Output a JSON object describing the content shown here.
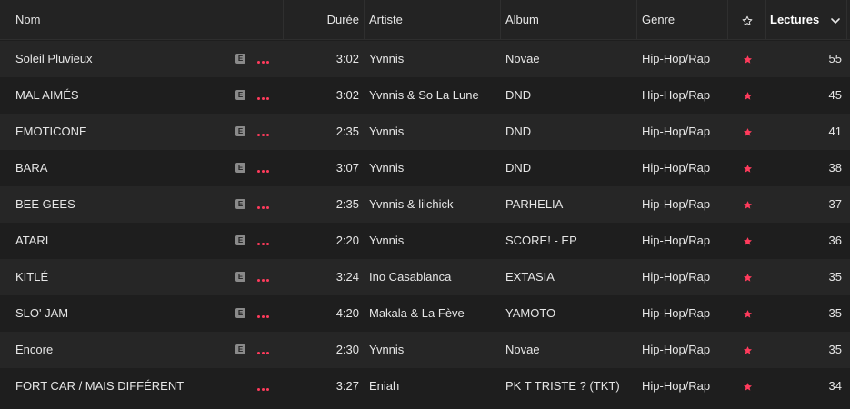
{
  "colors": {
    "accent": "#ff3b5c",
    "background": "#1e1e1e",
    "row_alt": "#262626",
    "header_bg": "#232323"
  },
  "header": {
    "nom": "Nom",
    "duree": "Durée",
    "artiste": "Artiste",
    "album": "Album",
    "genre": "Genre",
    "favorite_icon": "star-outline-icon",
    "lectures": "Lectures",
    "sort_icon": "chevron-down-icon"
  },
  "rows": [
    {
      "title": "Soleil Pluvieux",
      "explicit": true,
      "duration": "3:02",
      "artist": "Yvnnis",
      "album": "Novae",
      "genre": "Hip-Hop/Rap",
      "favorite": true,
      "plays": "55"
    },
    {
      "title": "MAL AIMÉS",
      "explicit": true,
      "duration": "3:02",
      "artist": "Yvnnis & So La Lune",
      "album": "DND",
      "genre": "Hip-Hop/Rap",
      "favorite": true,
      "plays": "45"
    },
    {
      "title": "EMOTICONE",
      "explicit": true,
      "duration": "2:35",
      "artist": "Yvnnis",
      "album": "DND",
      "genre": "Hip-Hop/Rap",
      "favorite": true,
      "plays": "41"
    },
    {
      "title": "BARA",
      "explicit": true,
      "duration": "3:07",
      "artist": "Yvnnis",
      "album": "DND",
      "genre": "Hip-Hop/Rap",
      "favorite": true,
      "plays": "38"
    },
    {
      "title": "BEE GEES",
      "explicit": true,
      "duration": "2:35",
      "artist": "Yvnnis & lilchick",
      "album": "PARHELIA",
      "genre": "Hip-Hop/Rap",
      "favorite": true,
      "plays": "37"
    },
    {
      "title": "ATARI",
      "explicit": true,
      "duration": "2:20",
      "artist": "Yvnnis",
      "album": "SCORE! - EP",
      "genre": "Hip-Hop/Rap",
      "favorite": true,
      "plays": "36"
    },
    {
      "title": "KITLÉ",
      "explicit": true,
      "duration": "3:24",
      "artist": "Ino Casablanca",
      "album": "EXTASIA",
      "genre": "Hip-Hop/Rap",
      "favorite": true,
      "plays": "35"
    },
    {
      "title": "SLO' JAM",
      "explicit": true,
      "duration": "4:20",
      "artist": "Makala & La Fève",
      "album": "YAMOTO",
      "genre": "Hip-Hop/Rap",
      "favorite": true,
      "plays": "35"
    },
    {
      "title": "Encore",
      "explicit": true,
      "duration": "2:30",
      "artist": "Yvnnis",
      "album": "Novae",
      "genre": "Hip-Hop/Rap",
      "favorite": true,
      "plays": "35"
    },
    {
      "title": "FORT CAR / MAIS DIFFÉRENT",
      "explicit": false,
      "duration": "3:27",
      "artist": "Eniah",
      "album": "PK T TRISTE ? (TKT)",
      "genre": "Hip-Hop/Rap",
      "favorite": true,
      "plays": "34"
    }
  ],
  "explicit_badge": "E",
  "more_icon": "more-dots-icon",
  "favorite_icon": "star-filled-icon"
}
